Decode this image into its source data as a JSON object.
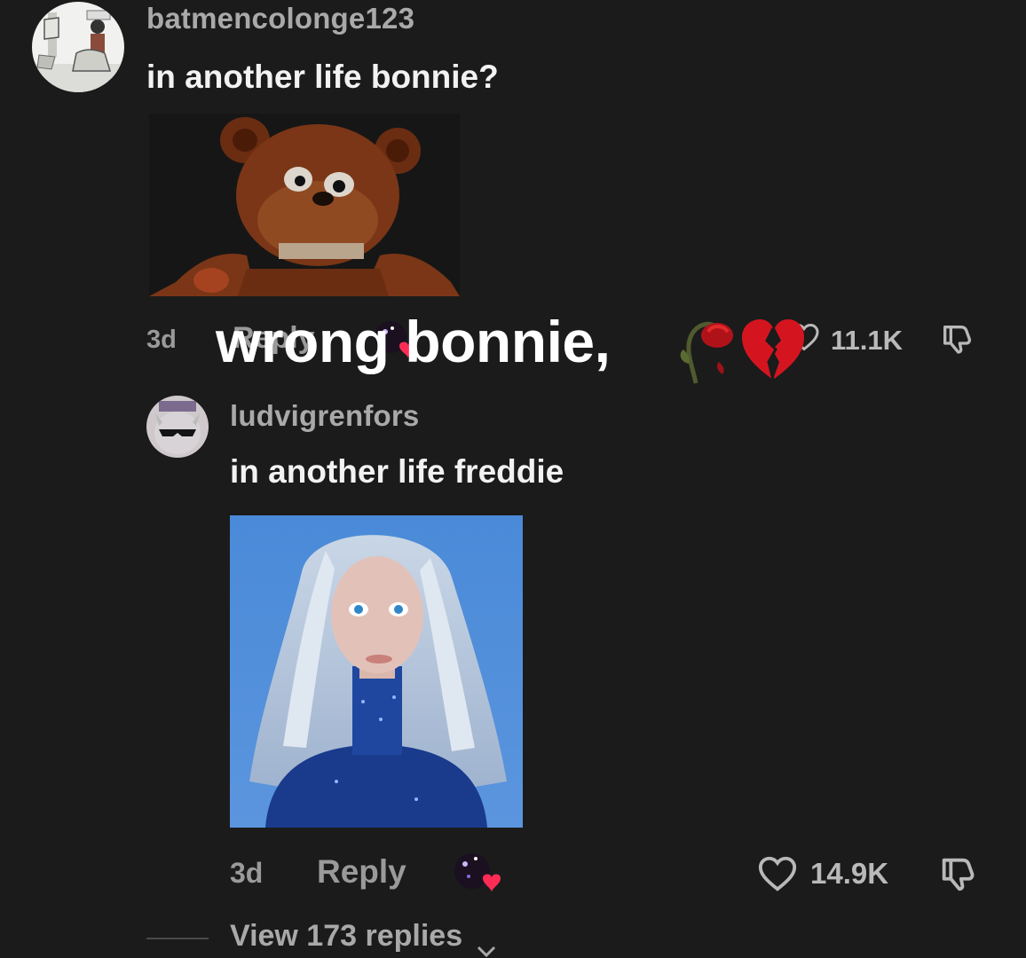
{
  "comments": [
    {
      "username": "batmencolonge123",
      "text": "in another life bonnie?",
      "time": "3d",
      "reply_label": "Reply",
      "like_count": "11.1K",
      "media": "freddy-fazbear-image"
    },
    {
      "username": "ludvigrenfors",
      "text": "in another life freddie",
      "time": "3d",
      "reply_label": "Reply",
      "like_count": "14.9K",
      "media": "blonde-woman-portrait-image"
    }
  ],
  "overlay_caption": "wrong bonnie,",
  "caption_emojis": [
    "wilted-rose-emoji",
    "broken-heart-emoji"
  ],
  "view_replies": "View 173 replies",
  "colors": {
    "background": "#1b1b1b",
    "accent_heart": "#ff2d55",
    "username": "#a9a9a9",
    "text": "#f2f2f2"
  }
}
